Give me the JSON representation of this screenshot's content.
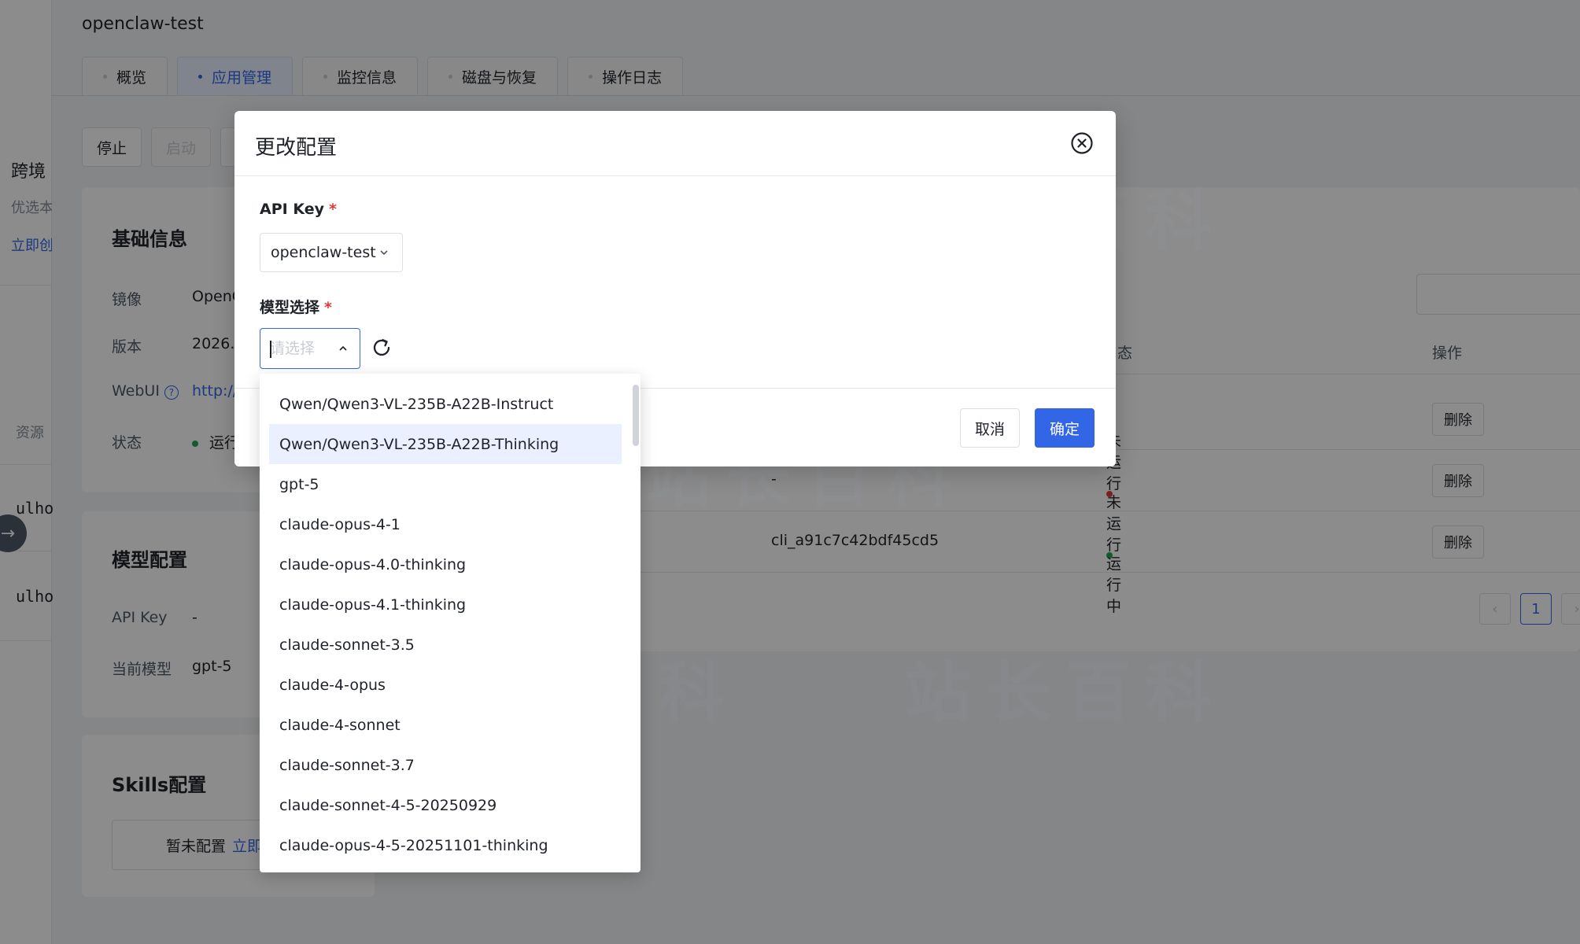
{
  "page": {
    "title": "openclaw-test",
    "tabs": [
      {
        "label": "概览"
      },
      {
        "label": "应用管理"
      },
      {
        "label": "监控信息"
      },
      {
        "label": "磁盘与恢复"
      },
      {
        "label": "操作日志"
      }
    ],
    "actions": {
      "stop": "停止",
      "start": "启动"
    }
  },
  "left_strip": {
    "frag_title": "跨境",
    "frag_sub": "优选本",
    "frag_link": "立即创",
    "frag_res": "资源",
    "frag_row1": "ulho",
    "frag_row2": "ulho"
  },
  "basic_info": {
    "title": "基础信息",
    "image_label": "镜像",
    "image_value": "OpenC",
    "version_label": "版本",
    "version_value": "2026.2",
    "webui_label": "WebUI",
    "webui_value": "http://",
    "status_label": "状态",
    "status_value": "运行"
  },
  "model_config": {
    "title": "模型配置",
    "apikey_label": "API Key",
    "apikey_value": "-",
    "current_model_label": "当前模型",
    "current_model_value": "gpt-5"
  },
  "skills": {
    "title": "Skills配置",
    "empty_text": "暂未配置",
    "link_text": "立即"
  },
  "table": {
    "col_status": "态",
    "col_actions": "操作",
    "rows": [
      {
        "key": "",
        "status": "未运行",
        "action": "删除"
      },
      {
        "key": "-",
        "status": "未运行",
        "action": "删除"
      },
      {
        "key": "cli_a91c7c42bdf45cd5",
        "status": "运行中",
        "action": "删除"
      }
    ],
    "pager": {
      "prev": "‹",
      "current": "1",
      "next": "›"
    }
  },
  "watermark": "站长百科",
  "modal": {
    "title": "更改配置",
    "apikey_label": "API Key",
    "apikey_value": "openclaw-test",
    "model_label": "模型选择",
    "model_placeholder": "请选择",
    "cancel": "取消",
    "ok": "确定",
    "required_mark": "*"
  },
  "dropdown": {
    "hover_index": 1,
    "options": [
      "Qwen/Qwen3-VL-235B-A22B-Instruct",
      "Qwen/Qwen3-VL-235B-A22B-Thinking",
      "gpt-5",
      "claude-opus-4-1",
      "claude-opus-4.0-thinking",
      "claude-opus-4.1-thinking",
      "claude-sonnet-3.5",
      "claude-4-opus",
      "claude-4-sonnet",
      "claude-sonnet-3.7",
      "claude-sonnet-4-5-20250929",
      "claude-opus-4-5-20251101-thinking"
    ]
  },
  "colors": {
    "accent": "#3366e6",
    "running": "#23a455",
    "stopped": "#e03a3a"
  }
}
